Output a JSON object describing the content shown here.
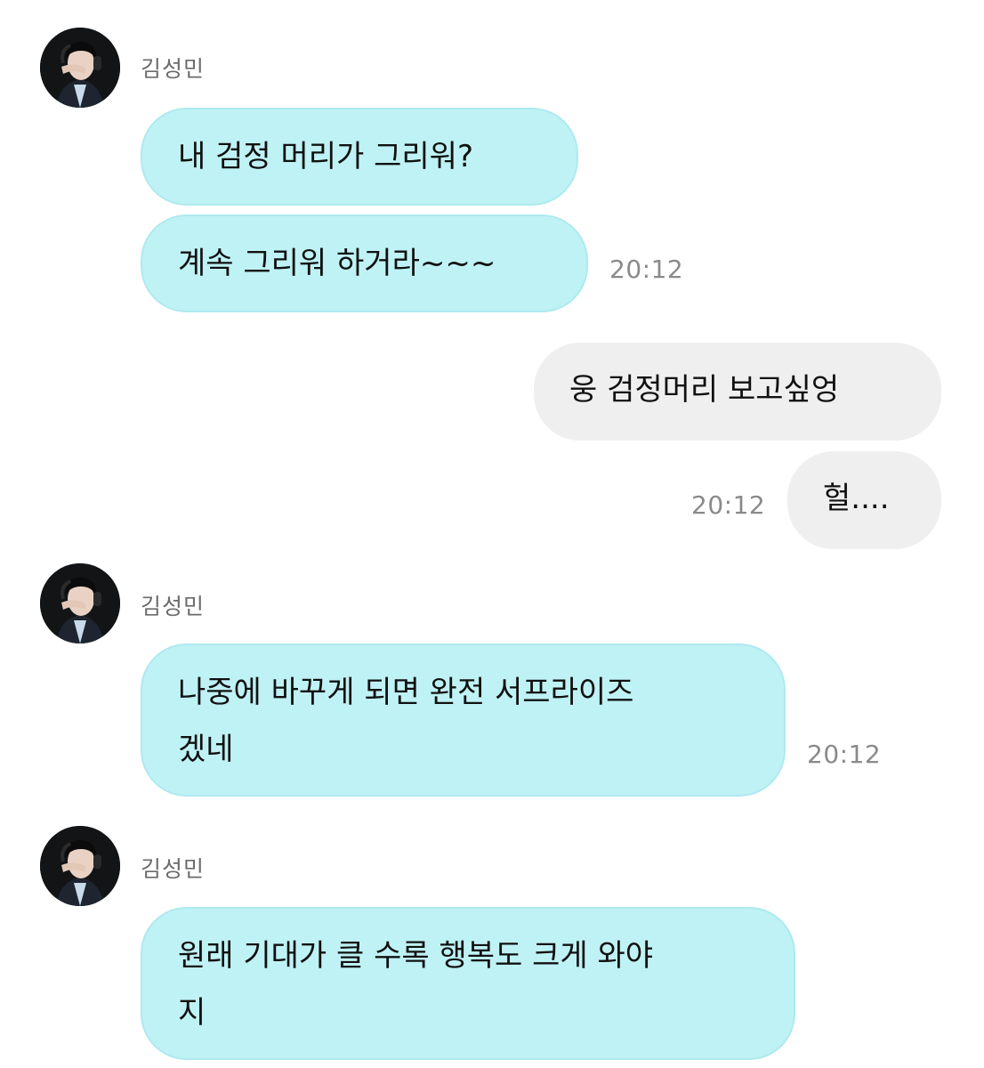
{
  "colors": {
    "incoming_bubble": "#bff2f5",
    "outgoing_bubble": "#efeff0",
    "timestamp": "#8a8a8a",
    "sender_name": "#6b6b6b"
  },
  "messages": {
    "group1": {
      "sender": "김성민",
      "bubble1": "내 검정 머리가 그리워?",
      "bubble2": "계속 그리워 하거라~~~",
      "time": "20:12"
    },
    "outgoing": {
      "bubble1": "웅 검정머리 보고싶엉",
      "bubble2": "헐....",
      "time": "20:12"
    },
    "group2": {
      "sender": "김성민",
      "bubble1_line1": "나중에 바꾸게 되면 완전 서프라이즈",
      "bubble1_line2": "겠네",
      "time": "20:12"
    },
    "group3": {
      "sender": "김성민",
      "bubble1_line1": "원래 기대가 클 수록 행복도 크게 와야",
      "bubble1_line2": "지"
    }
  }
}
